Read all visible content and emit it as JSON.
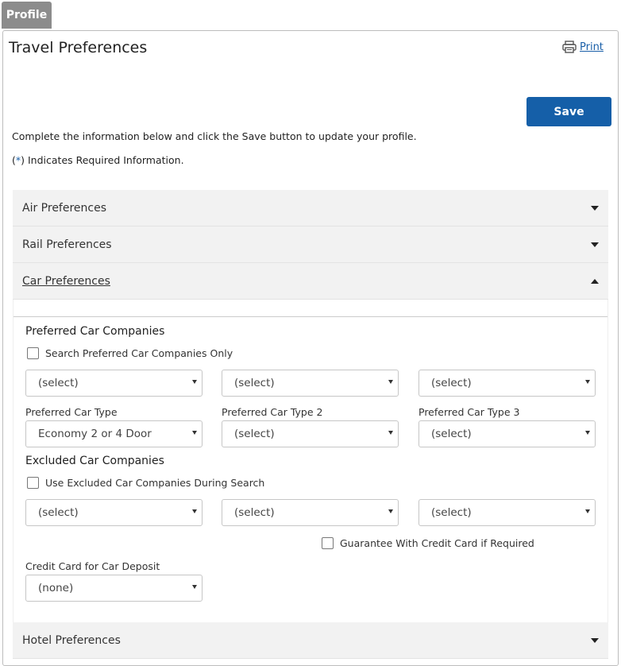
{
  "tab": {
    "label": "Profile"
  },
  "header": {
    "title": "Travel Preferences",
    "print_label": "Print"
  },
  "actions": {
    "save_label": "Save"
  },
  "intro": {
    "instructions": "Complete the information below and click the Save button to update your profile.",
    "required_star": "*",
    "required_text": ") Indicates Required Information.",
    "required_open": "("
  },
  "accordion": {
    "air": {
      "label": "Air Preferences",
      "state": "collapsed"
    },
    "rail": {
      "label": "Rail Preferences",
      "state": "collapsed"
    },
    "car": {
      "label": "Car Preferences",
      "state": "expanded"
    },
    "hotel": {
      "label": "Hotel Preferences",
      "state": "collapsed"
    }
  },
  "car": {
    "preferred_companies_heading": "Preferred Car Companies",
    "search_preferred_only_label": "Search Preferred Car Companies Only",
    "preferred_companies": [
      "(select)",
      "(select)",
      "(select)"
    ],
    "car_type_labels": [
      "Preferred Car Type",
      "Preferred Car Type 2",
      "Preferred Car Type 3"
    ],
    "car_types": [
      "Economy 2 or 4 Door",
      "(select)",
      "(select)"
    ],
    "excluded_companies_heading": "Excluded Car Companies",
    "use_excluded_label": "Use Excluded Car Companies During Search",
    "excluded_companies": [
      "(select)",
      "(select)",
      "(select)"
    ],
    "guarantee_label": "Guarantee With Credit Card if Required",
    "credit_card_label": "Credit Card for Car Deposit",
    "credit_card_value": "(none)"
  },
  "colors": {
    "accent": "#155fa8",
    "tab_bg": "#8c8c8c",
    "accordion_bg": "#f2f2f2"
  }
}
